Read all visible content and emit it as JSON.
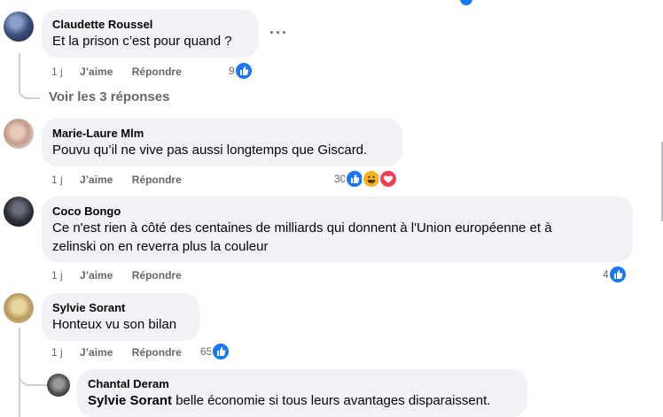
{
  "comments": [
    {
      "name": "Claudette Roussel",
      "text": "Et la prison c’est pour quand ?",
      "time": "1 j",
      "like": "J’aime",
      "reply": "Répondre",
      "count": "9"
    },
    {
      "name": "Marie-Laure Mlm",
      "text": "Pouvu qu’il ne vive pas aussi longtemps que Giscard.",
      "time": "1 j",
      "like": "J’aime",
      "reply": "Répondre",
      "count": "30"
    },
    {
      "name": "Coco Bongo",
      "text_line1": "Ce n'est rien à côté des centaines de milliards qui donnent à l'Union européenne et à",
      "text_line2": "zelinski on en reverra plus la couleur",
      "time": "1 j",
      "like": "J’aime",
      "reply": "Répondre",
      "count": "4"
    },
    {
      "name": "Sylvie Sorant",
      "text": "Honteux vu son bilan",
      "time": "1 j",
      "like": "J’aime",
      "reply": "Répondre",
      "count": "65"
    },
    {
      "name": "Chantal Deram",
      "mention": "Sylvie Sorant",
      "text": " belle économie si tous leurs avantages disparaissent."
    }
  ],
  "see_replies": "Voir les 3 réponses",
  "more_options": "···",
  "colors": {
    "like": "#1877f2",
    "haha": "#f7b125",
    "love": "#f33e58",
    "bubble": "#f0f2f5",
    "meta": "#65676b"
  }
}
